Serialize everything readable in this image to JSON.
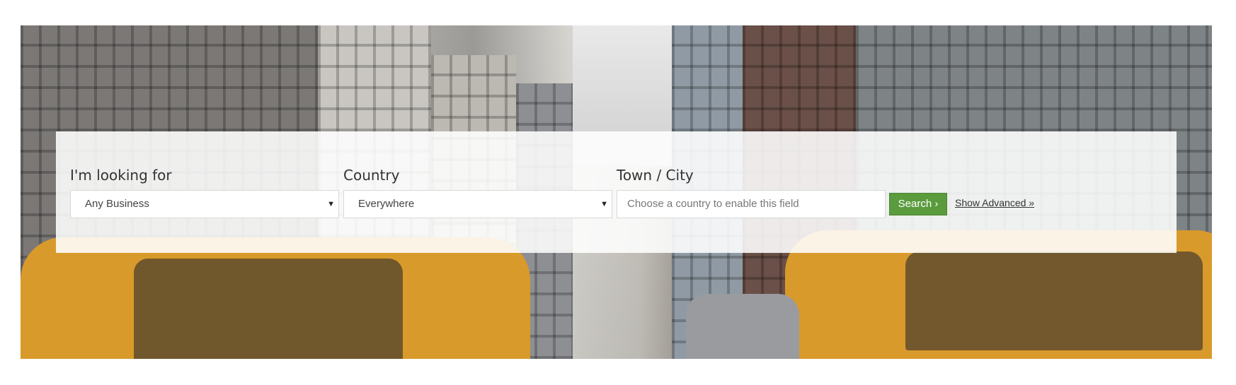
{
  "search": {
    "looking_for": {
      "label": "I'm looking for",
      "value": "Any Business"
    },
    "country": {
      "label": "Country",
      "value": "Everywhere"
    },
    "town": {
      "label": "Town / City",
      "placeholder": "Choose a country to enable this field"
    },
    "search_button": "Search ›",
    "advanced_link": "Show Advanced »"
  },
  "icons": {
    "dropdown": "▼"
  },
  "colors": {
    "button": "#5a9b3d",
    "panel": "rgba(255,255,255,0.88)"
  }
}
